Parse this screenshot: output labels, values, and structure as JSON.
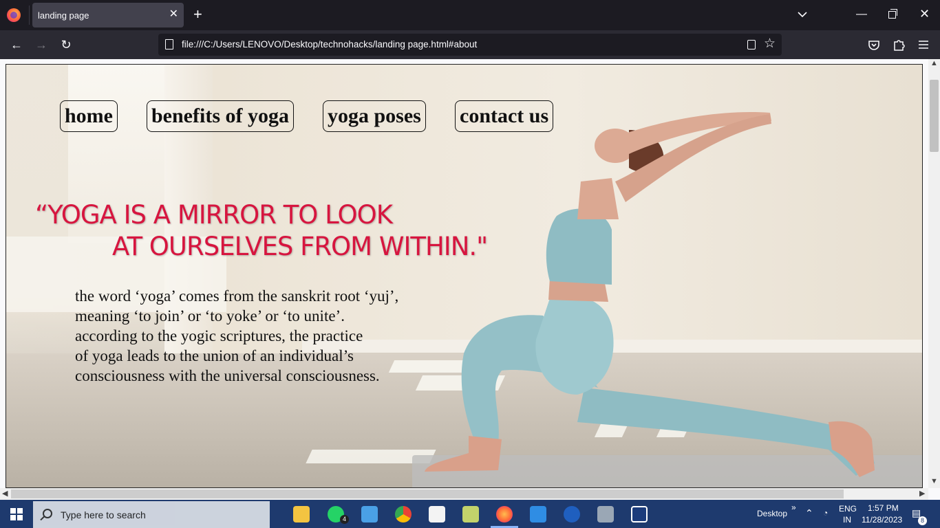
{
  "browser": {
    "tab_title": "landing page",
    "tab_close": "✕",
    "new_tab": "+",
    "url": "file:///C:/Users/LENOVO/Desktop/technohacks/landing page.html#about",
    "back": "←",
    "forward": "→",
    "reload": "↻",
    "star": "☆",
    "minimize": "—",
    "close": "✕",
    "toolbar_icons": [
      "pocket-icon",
      "extensions-icon",
      "menu-icon"
    ]
  },
  "page": {
    "nav": [
      {
        "label": "home"
      },
      {
        "label": "benefits of yoga"
      },
      {
        "label": "yoga poses"
      },
      {
        "label": "contact us"
      }
    ],
    "quote_line1": "“YOGA IS A MIRROR TO LOOK",
    "quote_line2": "AT  OURSELVES FROM WITHIN.\"",
    "description": [
      "the word ‘yoga’ comes from the sanskrit root ‘yuj’,",
      "meaning ‘to join’ or ‘to yoke’ or ‘to unite’.",
      "according to the yogic scriptures, the practice",
      "of yoga leads to the union of an individual’s",
      "consciousness with the universal consciousness."
    ],
    "accent_color": "#d7153f"
  },
  "taskbar": {
    "search_placeholder": "Type here to search",
    "apps": [
      "file-explorer",
      "whatsapp",
      "pc-app",
      "chrome",
      "microsoft-store",
      "spreadsheet-app",
      "firefox",
      "vscode",
      "t-app",
      "camera",
      "disney-plus"
    ],
    "whatsapp_badge": "4",
    "desktop_label": "Desktop",
    "chevron": "»",
    "lang": "ENG",
    "region": "IN",
    "time": "1:57 PM",
    "date": "11/28/2023",
    "notification_count": "8"
  }
}
